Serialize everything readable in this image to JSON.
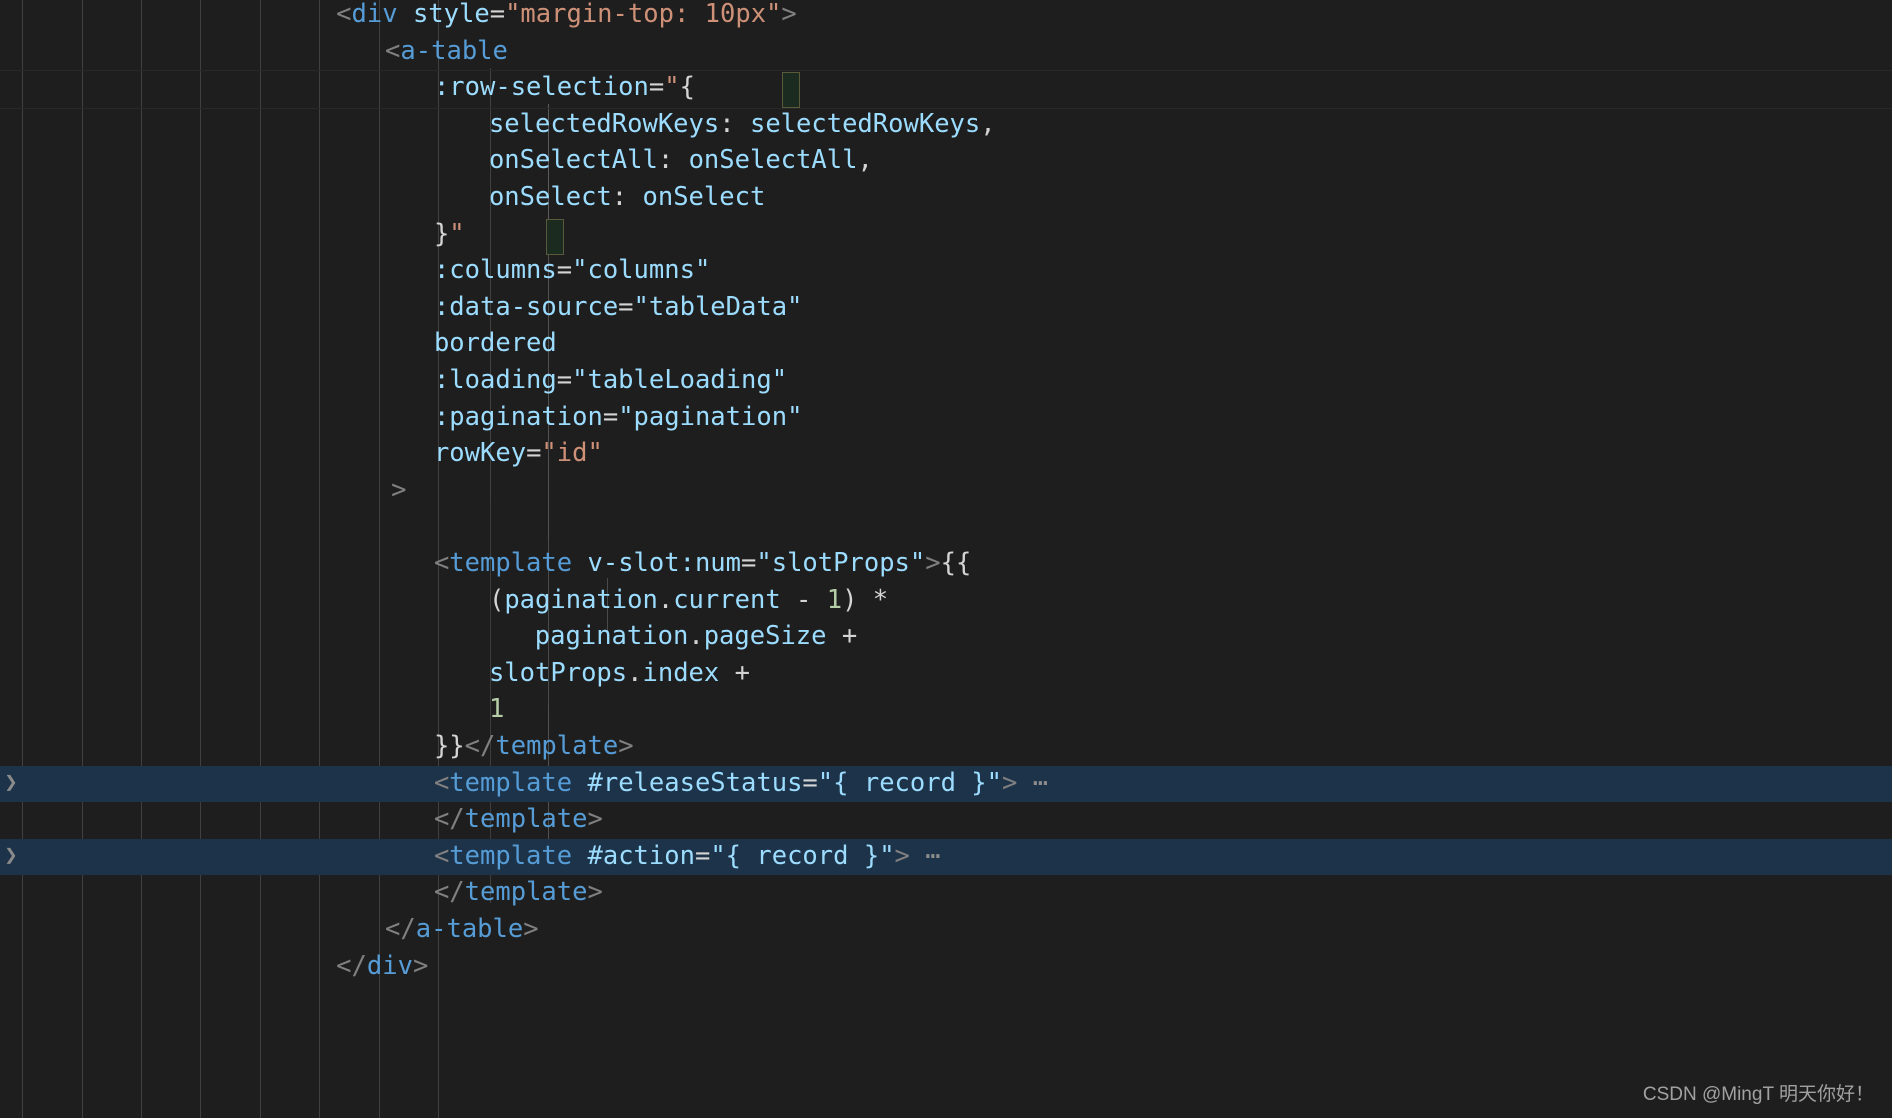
{
  "app": {
    "kind": "code-editor",
    "theme": "dark-plus",
    "background": "#1e1e1e",
    "language": "vue-html",
    "font_size_px": 25.5,
    "line_height_px": 36.6
  },
  "colors": {
    "background": "#1e1e1e",
    "indent_guide": "#404040",
    "selection_highlight": "#1d3349",
    "current_line_border": "#282828",
    "bracket_match_border": "#5a5a3a",
    "tag": "#569cd6",
    "attribute": "#9cdcfe",
    "string": "#ce9178",
    "number": "#b5cea8",
    "punctuation": "#808080",
    "operator": "#d4d4d4",
    "fold_marker": "#8c8c8c"
  },
  "editor": {
    "indent_guide_columns": 8,
    "lines": [
      {
        "id": "l01",
        "indent": 11,
        "text": "<div style=\"margin-top: 10px\">",
        "tokens": [
          {
            "t": "<",
            "c": "t-punct"
          },
          {
            "t": "div",
            "c": "t-tag"
          },
          {
            "t": " ",
            "c": "t-plain"
          },
          {
            "t": "style",
            "c": "t-attr"
          },
          {
            "t": "=",
            "c": "t-eq"
          },
          {
            "t": "\"margin-top: 10px\"",
            "c": "t-str"
          },
          {
            "t": ">",
            "c": "t-punct"
          }
        ]
      },
      {
        "id": "l02",
        "indent": 12.6,
        "text": "<a-table",
        "tokens": [
          {
            "t": "<",
            "c": "t-punct"
          },
          {
            "t": "a-table",
            "c": "t-tag"
          }
        ]
      },
      {
        "id": "l03",
        "indent": 14.2,
        "text": ":row-selection=\"{",
        "tokens": [
          {
            "t": ":row-selection",
            "c": "t-attr"
          },
          {
            "t": "=",
            "c": "t-eq"
          },
          {
            "t": "\"",
            "c": "t-str"
          },
          {
            "t": "{",
            "c": "t-brace"
          }
        ]
      },
      {
        "id": "l04",
        "indent": 16,
        "text": "selectedRowKeys: selectedRowKeys,",
        "tokens": [
          {
            "t": "selectedRowKeys",
            "c": "t-plain"
          },
          {
            "t": ": ",
            "c": "t-op"
          },
          {
            "t": "selectedRowKeys",
            "c": "t-plain"
          },
          {
            "t": ",",
            "c": "t-op"
          }
        ]
      },
      {
        "id": "l05",
        "indent": 16,
        "text": "onSelectAll: onSelectAll,",
        "tokens": [
          {
            "t": "onSelectAll",
            "c": "t-plain"
          },
          {
            "t": ": ",
            "c": "t-op"
          },
          {
            "t": "onSelectAll",
            "c": "t-plain"
          },
          {
            "t": ",",
            "c": "t-op"
          }
        ]
      },
      {
        "id": "l06",
        "indent": 16,
        "text": "onSelect: onSelect",
        "tokens": [
          {
            "t": "onSelect",
            "c": "t-plain"
          },
          {
            "t": ": ",
            "c": "t-op"
          },
          {
            "t": "onSelect",
            "c": "t-plain"
          }
        ]
      },
      {
        "id": "l07",
        "indent": 14.2,
        "text": "}\"",
        "tokens": [
          {
            "t": "}",
            "c": "t-brace"
          },
          {
            "t": "\"",
            "c": "t-str"
          }
        ]
      },
      {
        "id": "l08",
        "indent": 14.2,
        "text": ":columns=\"columns\"",
        "tokens": [
          {
            "t": ":columns",
            "c": "t-attr"
          },
          {
            "t": "=",
            "c": "t-eq"
          },
          {
            "t": "\"columns\"",
            "c": "t-attr"
          }
        ]
      },
      {
        "id": "l09",
        "indent": 14.2,
        "text": ":data-source=\"tableData\"",
        "tokens": [
          {
            "t": ":data-source",
            "c": "t-attr"
          },
          {
            "t": "=",
            "c": "t-eq"
          },
          {
            "t": "\"tableData\"",
            "c": "t-attr"
          }
        ]
      },
      {
        "id": "l10",
        "indent": 14.2,
        "text": "bordered",
        "tokens": [
          {
            "t": "bordered",
            "c": "t-attr"
          }
        ]
      },
      {
        "id": "l11",
        "indent": 14.2,
        "text": ":loading=\"tableLoading\"",
        "tokens": [
          {
            "t": ":loading",
            "c": "t-attr"
          },
          {
            "t": "=",
            "c": "t-eq"
          },
          {
            "t": "\"tableLoading\"",
            "c": "t-attr"
          }
        ]
      },
      {
        "id": "l12",
        "indent": 14.2,
        "text": ":pagination=\"pagination\"",
        "tokens": [
          {
            "t": ":pagination",
            "c": "t-attr"
          },
          {
            "t": "=",
            "c": "t-eq"
          },
          {
            "t": "\"pagination\"",
            "c": "t-attr"
          }
        ]
      },
      {
        "id": "l13",
        "indent": 14.2,
        "text": "rowKey=\"id\"",
        "tokens": [
          {
            "t": "rowKey",
            "c": "t-attr"
          },
          {
            "t": "=",
            "c": "t-eq"
          },
          {
            "t": "\"id\"",
            "c": "t-str"
          }
        ]
      },
      {
        "id": "l14",
        "indent": 12.8,
        "text": ">",
        "tokens": [
          {
            "t": ">",
            "c": "t-punct"
          }
        ]
      },
      {
        "id": "l15",
        "indent": 0,
        "text": "",
        "tokens": []
      },
      {
        "id": "l16",
        "indent": 14.2,
        "text": "<template v-slot:num=\"slotProps\">{{",
        "tokens": [
          {
            "t": "<",
            "c": "t-punct"
          },
          {
            "t": "template",
            "c": "t-tag"
          },
          {
            "t": " ",
            "c": "t-plain"
          },
          {
            "t": "v-slot:num",
            "c": "t-attr"
          },
          {
            "t": "=",
            "c": "t-eq"
          },
          {
            "t": "\"slotProps\"",
            "c": "t-attr"
          },
          {
            "t": ">",
            "c": "t-punct"
          },
          {
            "t": "{{",
            "c": "t-interp"
          }
        ]
      },
      {
        "id": "l17",
        "indent": 16,
        "text": "(pagination.current - 1) *",
        "tokens": [
          {
            "t": "(",
            "c": "t-op"
          },
          {
            "t": "pagination",
            "c": "t-plain"
          },
          {
            "t": ".",
            "c": "t-op"
          },
          {
            "t": "current",
            "c": "t-plain"
          },
          {
            "t": " - ",
            "c": "t-op"
          },
          {
            "t": "1",
            "c": "t-num"
          },
          {
            "t": ")",
            "c": "t-op"
          },
          {
            "t": " *",
            "c": "t-op"
          }
        ]
      },
      {
        "id": "l18",
        "indent": 17.5,
        "text": "pagination.pageSize +",
        "tokens": [
          {
            "t": "pagination",
            "c": "t-plain"
          },
          {
            "t": ".",
            "c": "t-op"
          },
          {
            "t": "pageSize",
            "c": "t-plain"
          },
          {
            "t": " +",
            "c": "t-op"
          }
        ]
      },
      {
        "id": "l19",
        "indent": 16,
        "text": "slotProps.index +",
        "tokens": [
          {
            "t": "slotProps",
            "c": "t-plain"
          },
          {
            "t": ".",
            "c": "t-op"
          },
          {
            "t": "index",
            "c": "t-plain"
          },
          {
            "t": " +",
            "c": "t-op"
          }
        ]
      },
      {
        "id": "l20",
        "indent": 16,
        "text": "1",
        "tokens": [
          {
            "t": "1",
            "c": "t-num"
          }
        ]
      },
      {
        "id": "l21",
        "indent": 14.2,
        "text": "}}</template>",
        "tokens": [
          {
            "t": "}}",
            "c": "t-interp"
          },
          {
            "t": "</",
            "c": "t-punct"
          },
          {
            "t": "template",
            "c": "t-tag"
          },
          {
            "t": ">",
            "c": "t-punct"
          }
        ]
      },
      {
        "id": "l22",
        "indent": 14.2,
        "text": "<template #releaseStatus=\"{ record }\">⋯",
        "folded": true,
        "selected": true,
        "tokens": [
          {
            "t": "<",
            "c": "t-punct"
          },
          {
            "t": "template",
            "c": "t-tag"
          },
          {
            "t": " ",
            "c": "t-plain"
          },
          {
            "t": "#releaseStatus",
            "c": "t-attr"
          },
          {
            "t": "=",
            "c": "t-eq"
          },
          {
            "t": "\"{ record }\"",
            "c": "t-attr"
          },
          {
            "t": ">",
            "c": "t-punct"
          },
          {
            "t": " ⋯",
            "c": "fold-dots"
          }
        ]
      },
      {
        "id": "l23",
        "indent": 14.2,
        "text": "</template>",
        "tokens": [
          {
            "t": "</",
            "c": "t-punct"
          },
          {
            "t": "template",
            "c": "t-tag"
          },
          {
            "t": ">",
            "c": "t-punct"
          }
        ]
      },
      {
        "id": "l24",
        "indent": 14.2,
        "text": "<template #action=\"{ record }\">⋯",
        "folded": true,
        "selected": true,
        "tokens": [
          {
            "t": "<",
            "c": "t-punct"
          },
          {
            "t": "template",
            "c": "t-tag"
          },
          {
            "t": " ",
            "c": "t-plain"
          },
          {
            "t": "#action",
            "c": "t-attr"
          },
          {
            "t": "=",
            "c": "t-eq"
          },
          {
            "t": "\"{ record }\"",
            "c": "t-attr"
          },
          {
            "t": ">",
            "c": "t-punct"
          },
          {
            "t": " ⋯",
            "c": "fold-dots"
          }
        ]
      },
      {
        "id": "l25",
        "indent": 14.2,
        "text": "</template>",
        "tokens": [
          {
            "t": "</",
            "c": "t-punct"
          },
          {
            "t": "template",
            "c": "t-tag"
          },
          {
            "t": ">",
            "c": "t-punct"
          }
        ]
      },
      {
        "id": "l26",
        "indent": 12.6,
        "text": "</a-table>",
        "tokens": [
          {
            "t": "</",
            "c": "t-punct"
          },
          {
            "t": "a-table",
            "c": "t-tag"
          },
          {
            "t": ">",
            "c": "t-punct"
          }
        ]
      },
      {
        "id": "l27",
        "indent": 11,
        "text": "</div>",
        "tokens": [
          {
            "t": "</",
            "c": "t-punct"
          },
          {
            "t": "div",
            "c": "t-tag"
          },
          {
            "t": ">",
            "c": "t-punct"
          }
        ]
      }
    ],
    "fold_chevron": "❯",
    "fold_ellipsis": "⋯"
  },
  "watermark": {
    "text": "CSDN @MingT 明天你好！"
  }
}
